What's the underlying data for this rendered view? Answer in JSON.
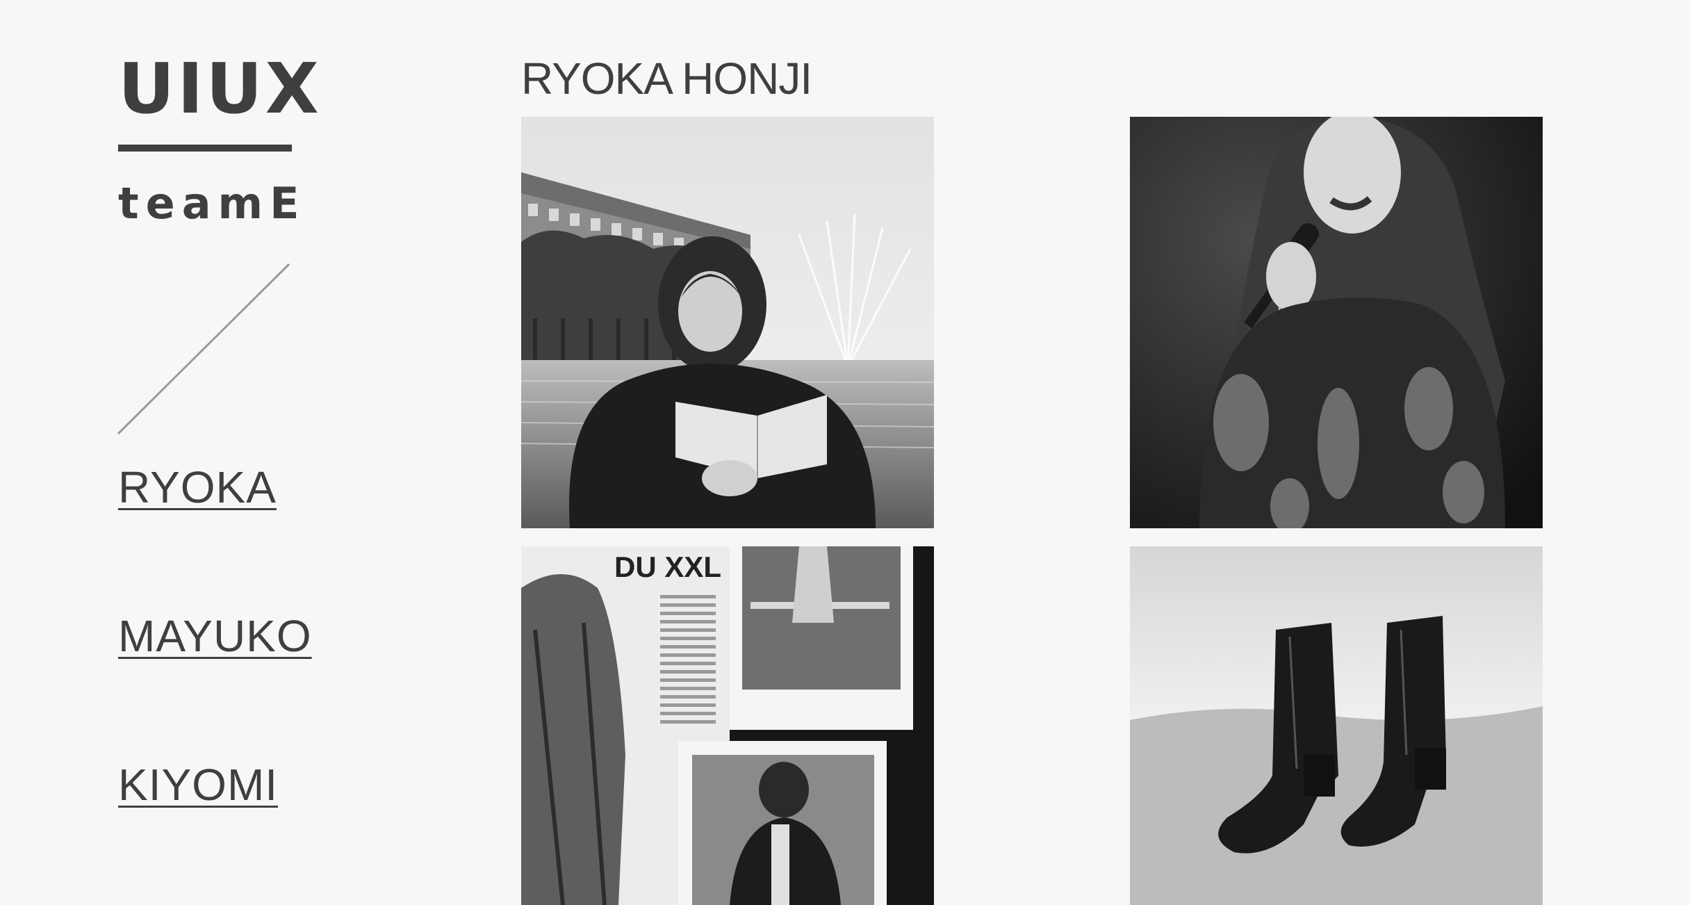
{
  "logo": {
    "main": "UIUX",
    "sub": "teamE"
  },
  "nav": {
    "items": [
      {
        "label": "RYOKA"
      },
      {
        "label": "MAYUKO"
      },
      {
        "label": "KIYOMI"
      }
    ]
  },
  "main": {
    "title": "RYOKA HONJI",
    "photos": [
      {
        "subject": "girl-reading-book-by-fountain"
      },
      {
        "subject": "singer-with-microphone"
      },
      {
        "subject": "magazine-collage",
        "headline": "DU XXL"
      },
      {
        "subject": "black-tabi-boots"
      }
    ]
  },
  "colors": {
    "background": "#f7f7f7",
    "text": "#3f3f3f"
  }
}
